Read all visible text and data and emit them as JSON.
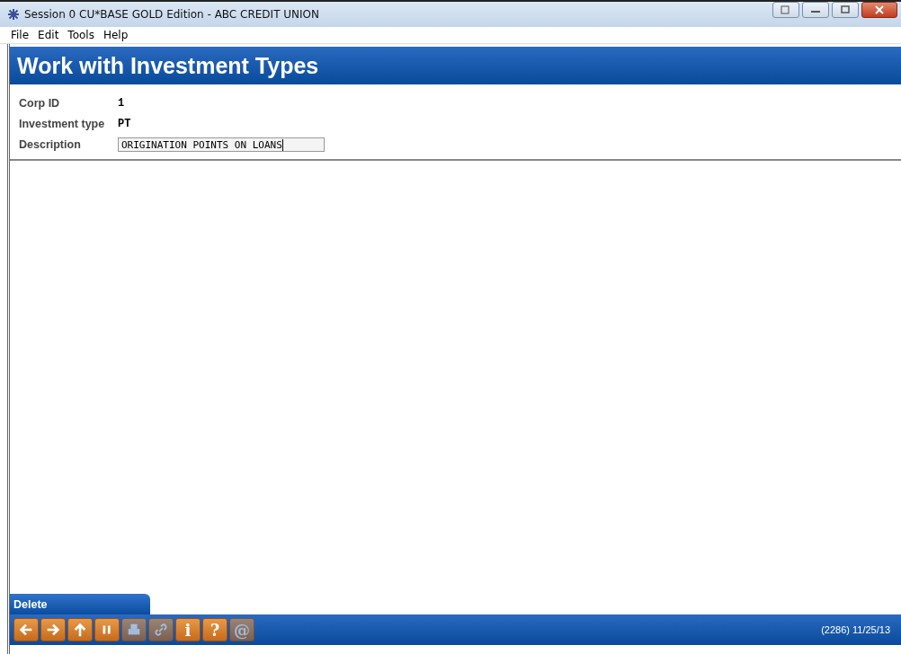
{
  "window": {
    "title": "Session 0 CU*BASE GOLD Edition - ABC CREDIT UNION"
  },
  "menu": [
    "File",
    "Edit",
    "Tools",
    "Help"
  ],
  "header": {
    "title": "Work with Investment Types"
  },
  "fields": [
    {
      "label": "Corp ID",
      "kind": "value",
      "value": "1"
    },
    {
      "label": "Investment type",
      "kind": "value",
      "value": "PT"
    },
    {
      "label": "Description",
      "kind": "input",
      "value": "ORIGINATION POINTS ON LOANS"
    }
  ],
  "action_tab": {
    "label": "Delete"
  },
  "toolbar": [
    {
      "kind": "back",
      "disabled": false
    },
    {
      "kind": "forward",
      "disabled": false
    },
    {
      "kind": "up",
      "disabled": false
    },
    {
      "kind": "pause",
      "disabled": false
    },
    {
      "kind": "print",
      "disabled": true
    },
    {
      "kind": "link",
      "disabled": true
    },
    {
      "kind": "text",
      "label": "i",
      "disabled": false
    },
    {
      "kind": "text",
      "label": "?",
      "disabled": false
    },
    {
      "kind": "text",
      "label": "@",
      "disabled": true
    }
  ],
  "status": "(2286) 11/25/13"
}
